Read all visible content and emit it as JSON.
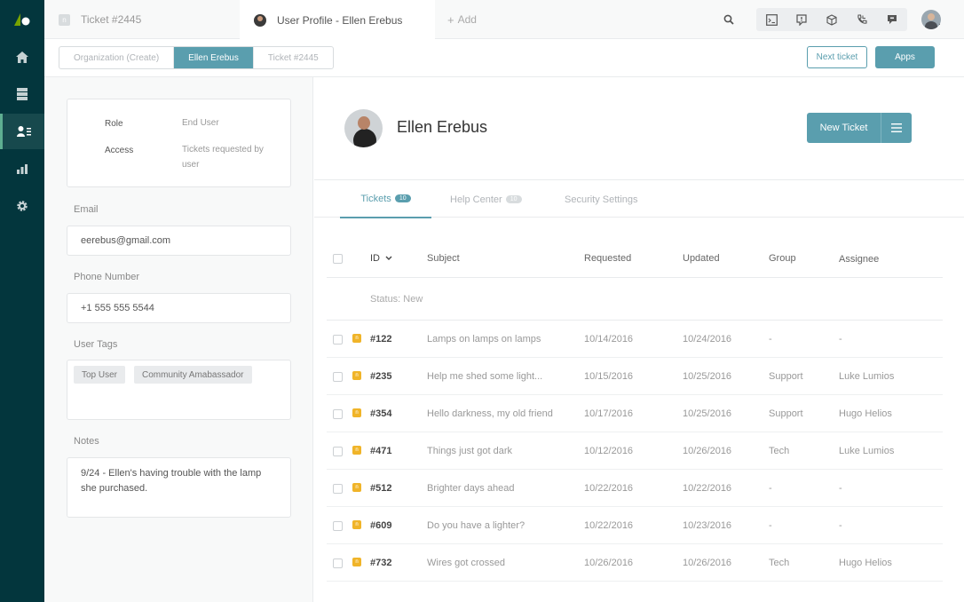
{
  "colors": {
    "nav_bg": "#03363d",
    "accent": "#5a9eae",
    "status_new": "#f0b429"
  },
  "topbar": {
    "tabs": [
      {
        "label": "Ticket #2445",
        "icon": "n-badge"
      },
      {
        "label": "User Profile - Ellen Erebus",
        "icon": "avatar"
      },
      {
        "label": "Add",
        "icon": "plus-icon"
      }
    ],
    "tab_badge": "n"
  },
  "breadcrumb": [
    "Organization (Create)",
    "Ellen Erebus",
    "Ticket #2445"
  ],
  "actions": {
    "next_ticket": "Next ticket",
    "apps": "Apps"
  },
  "user_card": {
    "role_label": "Role",
    "role_value": "End User",
    "access_label": "Access",
    "access_value": "Tickets requested by user"
  },
  "fields": {
    "email_label": "Email",
    "email_value": "eerebus@gmail.com",
    "phone_label": "Phone Number",
    "phone_value": "+1 555 555 5544",
    "tags_label": "User Tags",
    "tags": [
      "Top User",
      "Community Amabassador"
    ],
    "notes_label": "Notes",
    "notes_value": "9/24 - Ellen's having trouble with the lamp she purchased."
  },
  "profile": {
    "name": "Ellen Erebus",
    "new_ticket": "New Ticket"
  },
  "main_tabs": [
    {
      "label": "Tickets",
      "count": "10"
    },
    {
      "label": "Help Center",
      "count": "10"
    },
    {
      "label": "Security Settings",
      "count": ""
    }
  ],
  "table": {
    "headers": {
      "id": "ID",
      "subject": "Subject",
      "requested": "Requested",
      "updated": "Updated",
      "group": "Group",
      "assignee": "Assignee"
    },
    "status_group": "Status: New",
    "status_badge": "n",
    "rows": [
      {
        "id": "#122",
        "subject": "Lamps on lamps on lamps",
        "requested": "10/14/2016",
        "updated": "10/24/2016",
        "group": "-",
        "assignee": "-"
      },
      {
        "id": "#235",
        "subject": "Help me shed some light...",
        "requested": "10/15/2016",
        "updated": "10/25/2016",
        "group": "Support",
        "assignee": "Luke Lumios"
      },
      {
        "id": "#354",
        "subject": "Hello darkness, my old friend",
        "requested": "10/17/2016",
        "updated": "10/25/2016",
        "group": "Support",
        "assignee": "Hugo Helios"
      },
      {
        "id": "#471",
        "subject": "Things just got dark",
        "requested": "10/12/2016",
        "updated": "10/26/2016",
        "group": "Tech",
        "assignee": "Luke Lumios"
      },
      {
        "id": "#512",
        "subject": "Brighter days ahead",
        "requested": "10/22/2016",
        "updated": "10/22/2016",
        "group": "-",
        "assignee": "-"
      },
      {
        "id": "#609",
        "subject": "Do you have a lighter?",
        "requested": "10/22/2016",
        "updated": "10/23/2016",
        "group": "-",
        "assignee": "-"
      },
      {
        "id": "#732",
        "subject": "Wires got crossed",
        "requested": "10/26/2016",
        "updated": "10/26/2016",
        "group": "Tech",
        "assignee": "Hugo Helios"
      }
    ]
  }
}
